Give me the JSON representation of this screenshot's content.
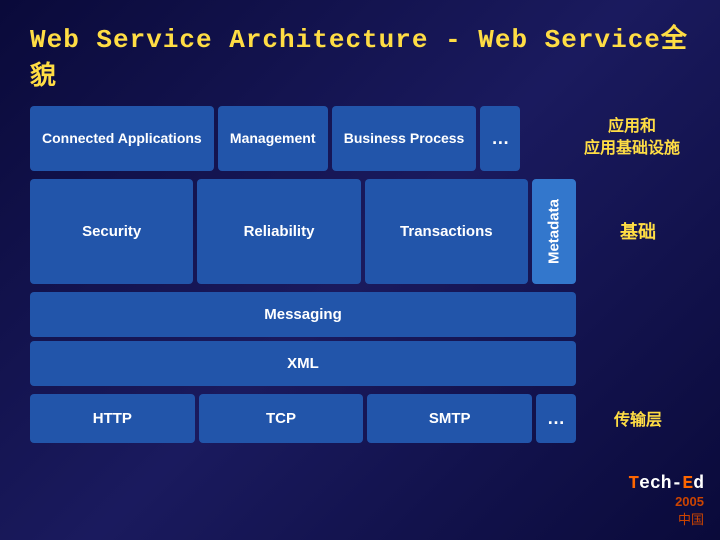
{
  "title": "Web Service Architecture - Web Service全貌",
  "top": {
    "connected_applications": "Connected Applications",
    "management": "Management",
    "business_process": "Business Process",
    "dots": "…",
    "label_right": "应用和\n应用基础设施"
  },
  "middle": {
    "security": "Security",
    "reliability": "Reliability",
    "transactions": "Transactions",
    "metadata": "Metadata",
    "label_right": "基础"
  },
  "bottom": {
    "messaging": "Messaging",
    "xml": "XML"
  },
  "transport": {
    "http": "HTTP",
    "tcp": "TCP",
    "smtp": "SMTP",
    "dots": "…",
    "label_right": "传输层"
  },
  "logo": {
    "brand": "Tech-Ed",
    "year": "2005",
    "region": "中国"
  }
}
